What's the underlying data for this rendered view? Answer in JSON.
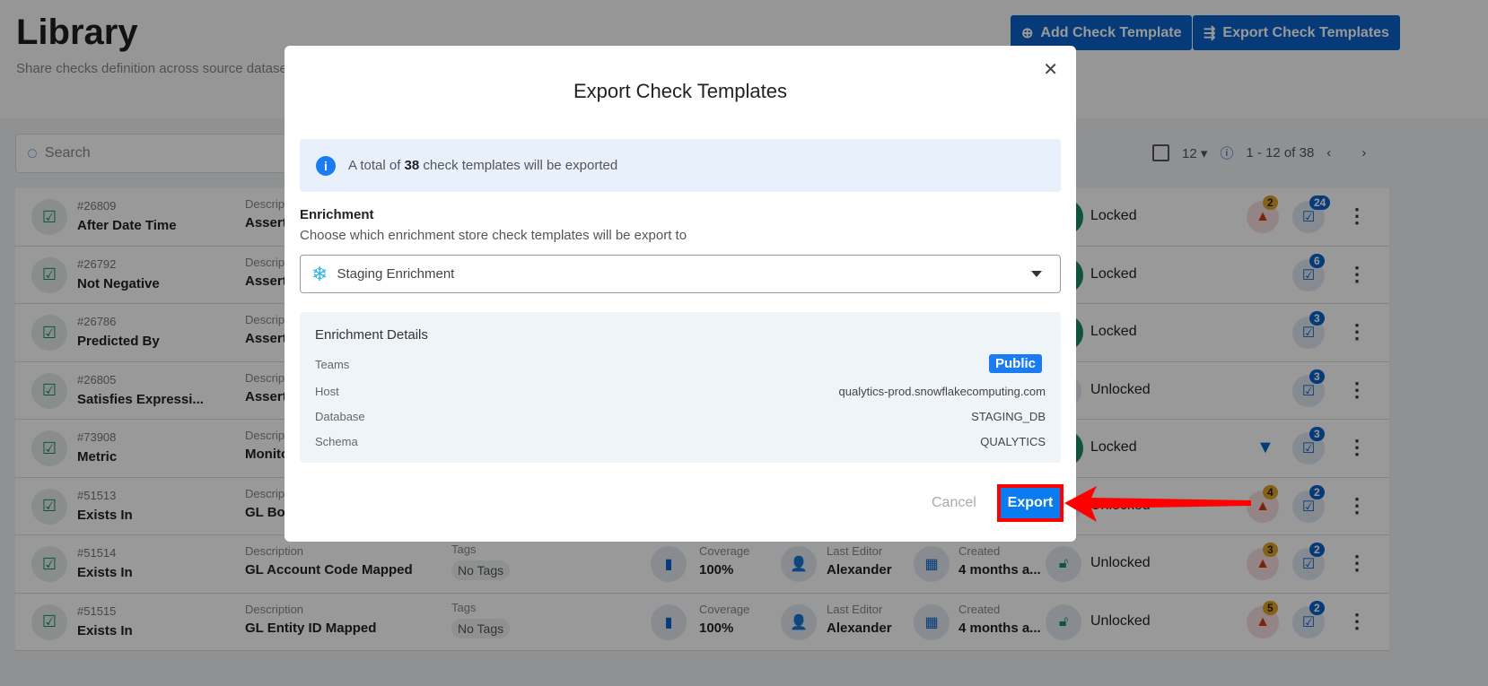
{
  "header": {
    "title": "Library",
    "subtitle": "Share checks definition across source datasets",
    "add_button": "Add Check Template",
    "export_button": "Export Check Templates"
  },
  "search": {
    "placeholder": "Search"
  },
  "pager": {
    "page_size": "12",
    "range": "1 - 12 of 38"
  },
  "rows": [
    {
      "id": "#26809",
      "name": "After Date Time",
      "desc_label": "Description",
      "desc": "Assert",
      "status": "Locked",
      "alerts": "2",
      "checks": "24"
    },
    {
      "id": "#26792",
      "name": "Not Negative",
      "desc_label": "Description",
      "desc": "Assert",
      "status": "Locked",
      "alerts": null,
      "checks": "6"
    },
    {
      "id": "#26786",
      "name": "Predicted By",
      "desc_label": "Description",
      "desc": "Assert",
      "status": "Locked",
      "alerts": null,
      "checks": "3"
    },
    {
      "id": "#26805",
      "name": "Satisfies Expressi...",
      "desc_label": "Description",
      "desc": "Assert",
      "status": "Unlocked",
      "alerts": null,
      "checks": "3"
    },
    {
      "id": "#73908",
      "name": "Metric",
      "desc_label": "Description",
      "desc": "Monito",
      "status": "Locked",
      "alerts": null,
      "checks": "3"
    },
    {
      "id": "#51513",
      "name": "Exists In",
      "desc_label": "Description",
      "desc": "GL Boo",
      "status": "Unlocked",
      "alerts": "4",
      "checks": "2"
    },
    {
      "id": "#51514",
      "name": "Exists In",
      "desc_label": "Description",
      "desc": "GL Account Code Mapped",
      "tags_label": "Tags",
      "tags": "No Tags",
      "coverage_label": "Coverage",
      "coverage": "100%",
      "editor_label": "Last Editor",
      "editor": "Alexander",
      "created_label": "Created",
      "created": "4 months a...",
      "status": "Unlocked",
      "alerts": "3",
      "checks": "2"
    },
    {
      "id": "#51515",
      "name": "Exists In",
      "desc_label": "Description",
      "desc": "GL Entity ID Mapped",
      "tags_label": "Tags",
      "tags": "No Tags",
      "coverage_label": "Coverage",
      "coverage": "100%",
      "editor_label": "Last Editor",
      "editor": "Alexander",
      "created_label": "Created",
      "created": "4 months a...",
      "status": "Unlocked",
      "alerts": "5",
      "checks": "2"
    }
  ],
  "modal": {
    "title": "Export Check Templates",
    "info_prefix": "A total of ",
    "info_count": "38",
    "info_suffix": " check templates will be exported",
    "enrichment_label": "Enrichment",
    "enrichment_help": "Choose which enrichment store check templates will be export to",
    "selected": "Staging Enrichment",
    "details": {
      "title": "Enrichment Details",
      "teams_label": "Teams",
      "teams": "Public",
      "host_label": "Host",
      "host": "qualytics-prod.snowflakecomputing.com",
      "db_label": "Database",
      "db": "STAGING_DB",
      "schema_label": "Schema",
      "schema": "QUALYTICS"
    },
    "cancel": "Cancel",
    "export": "Export"
  }
}
